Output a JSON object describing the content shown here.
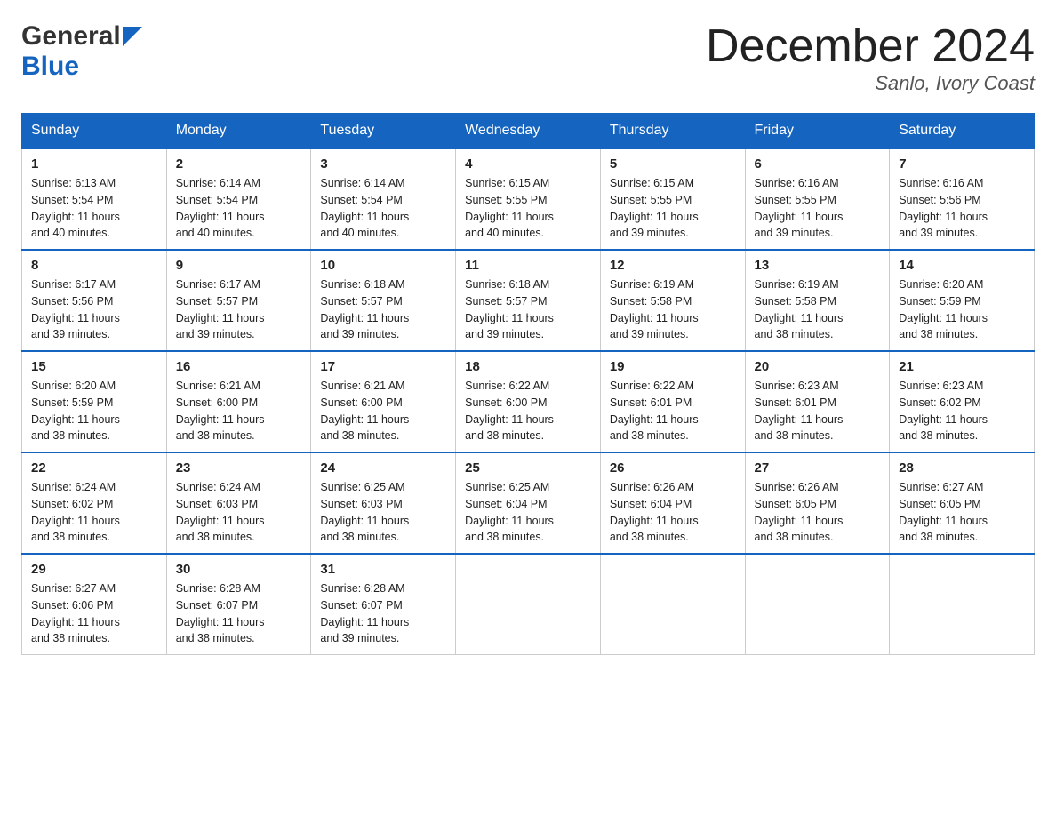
{
  "logo": {
    "general": "General",
    "blue": "Blue"
  },
  "title": "December 2024",
  "location": "Sanlo, Ivory Coast",
  "weekdays": [
    "Sunday",
    "Monday",
    "Tuesday",
    "Wednesday",
    "Thursday",
    "Friday",
    "Saturday"
  ],
  "weeks": [
    [
      {
        "day": "1",
        "sunrise": "6:13 AM",
        "sunset": "5:54 PM",
        "daylight": "11 hours and 40 minutes."
      },
      {
        "day": "2",
        "sunrise": "6:14 AM",
        "sunset": "5:54 PM",
        "daylight": "11 hours and 40 minutes."
      },
      {
        "day": "3",
        "sunrise": "6:14 AM",
        "sunset": "5:54 PM",
        "daylight": "11 hours and 40 minutes."
      },
      {
        "day": "4",
        "sunrise": "6:15 AM",
        "sunset": "5:55 PM",
        "daylight": "11 hours and 40 minutes."
      },
      {
        "day": "5",
        "sunrise": "6:15 AM",
        "sunset": "5:55 PM",
        "daylight": "11 hours and 39 minutes."
      },
      {
        "day": "6",
        "sunrise": "6:16 AM",
        "sunset": "5:55 PM",
        "daylight": "11 hours and 39 minutes."
      },
      {
        "day": "7",
        "sunrise": "6:16 AM",
        "sunset": "5:56 PM",
        "daylight": "11 hours and 39 minutes."
      }
    ],
    [
      {
        "day": "8",
        "sunrise": "6:17 AM",
        "sunset": "5:56 PM",
        "daylight": "11 hours and 39 minutes."
      },
      {
        "day": "9",
        "sunrise": "6:17 AM",
        "sunset": "5:57 PM",
        "daylight": "11 hours and 39 minutes."
      },
      {
        "day": "10",
        "sunrise": "6:18 AM",
        "sunset": "5:57 PM",
        "daylight": "11 hours and 39 minutes."
      },
      {
        "day": "11",
        "sunrise": "6:18 AM",
        "sunset": "5:57 PM",
        "daylight": "11 hours and 39 minutes."
      },
      {
        "day": "12",
        "sunrise": "6:19 AM",
        "sunset": "5:58 PM",
        "daylight": "11 hours and 39 minutes."
      },
      {
        "day": "13",
        "sunrise": "6:19 AM",
        "sunset": "5:58 PM",
        "daylight": "11 hours and 38 minutes."
      },
      {
        "day": "14",
        "sunrise": "6:20 AM",
        "sunset": "5:59 PM",
        "daylight": "11 hours and 38 minutes."
      }
    ],
    [
      {
        "day": "15",
        "sunrise": "6:20 AM",
        "sunset": "5:59 PM",
        "daylight": "11 hours and 38 minutes."
      },
      {
        "day": "16",
        "sunrise": "6:21 AM",
        "sunset": "6:00 PM",
        "daylight": "11 hours and 38 minutes."
      },
      {
        "day": "17",
        "sunrise": "6:21 AM",
        "sunset": "6:00 PM",
        "daylight": "11 hours and 38 minutes."
      },
      {
        "day": "18",
        "sunrise": "6:22 AM",
        "sunset": "6:00 PM",
        "daylight": "11 hours and 38 minutes."
      },
      {
        "day": "19",
        "sunrise": "6:22 AM",
        "sunset": "6:01 PM",
        "daylight": "11 hours and 38 minutes."
      },
      {
        "day": "20",
        "sunrise": "6:23 AM",
        "sunset": "6:01 PM",
        "daylight": "11 hours and 38 minutes."
      },
      {
        "day": "21",
        "sunrise": "6:23 AM",
        "sunset": "6:02 PM",
        "daylight": "11 hours and 38 minutes."
      }
    ],
    [
      {
        "day": "22",
        "sunrise": "6:24 AM",
        "sunset": "6:02 PM",
        "daylight": "11 hours and 38 minutes."
      },
      {
        "day": "23",
        "sunrise": "6:24 AM",
        "sunset": "6:03 PM",
        "daylight": "11 hours and 38 minutes."
      },
      {
        "day": "24",
        "sunrise": "6:25 AM",
        "sunset": "6:03 PM",
        "daylight": "11 hours and 38 minutes."
      },
      {
        "day": "25",
        "sunrise": "6:25 AM",
        "sunset": "6:04 PM",
        "daylight": "11 hours and 38 minutes."
      },
      {
        "day": "26",
        "sunrise": "6:26 AM",
        "sunset": "6:04 PM",
        "daylight": "11 hours and 38 minutes."
      },
      {
        "day": "27",
        "sunrise": "6:26 AM",
        "sunset": "6:05 PM",
        "daylight": "11 hours and 38 minutes."
      },
      {
        "day": "28",
        "sunrise": "6:27 AM",
        "sunset": "6:05 PM",
        "daylight": "11 hours and 38 minutes."
      }
    ],
    [
      {
        "day": "29",
        "sunrise": "6:27 AM",
        "sunset": "6:06 PM",
        "daylight": "11 hours and 38 minutes."
      },
      {
        "day": "30",
        "sunrise": "6:28 AM",
        "sunset": "6:07 PM",
        "daylight": "11 hours and 38 minutes."
      },
      {
        "day": "31",
        "sunrise": "6:28 AM",
        "sunset": "6:07 PM",
        "daylight": "11 hours and 39 minutes."
      },
      null,
      null,
      null,
      null
    ]
  ],
  "labels": {
    "sunrise": "Sunrise:",
    "sunset": "Sunset:",
    "daylight": "Daylight:"
  }
}
